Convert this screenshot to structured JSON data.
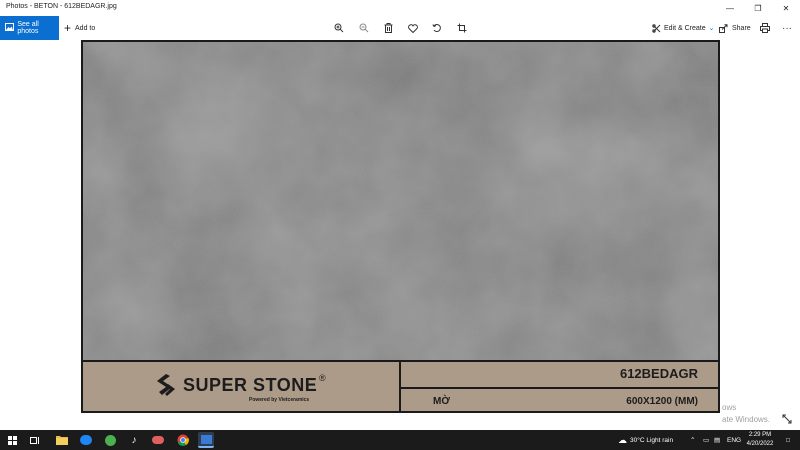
{
  "window": {
    "title": "Photos - BETON - 612BEDAGR.jpg",
    "minimize_glyph": "—",
    "maximize_glyph": "❐",
    "close_glyph": "✕"
  },
  "toolbar": {
    "see_all_label": "See all photos",
    "add_to_label": "Add to",
    "add_to_glyph": "+",
    "edit_create_label": "Edit & Create",
    "share_label": "Share",
    "more_glyph": "···"
  },
  "photo": {
    "brand_name": "SUPER STONE",
    "brand_registered": "®",
    "brand_tagline": "Powered by Vietceramics",
    "product_code": "612BEDAGR",
    "finish": "MỜ",
    "size": "600X1200 (MM)"
  },
  "watermark": {
    "line1": "ows",
    "line2": "ate Windows."
  },
  "taskbar": {
    "weather": "30°C  Light rain",
    "language": "ENG",
    "time": "2:29 PM",
    "date": "4/20/2022"
  },
  "icons": [
    "windows-start",
    "task-view",
    "file-explorer",
    "zalo",
    "chat-app",
    "tiktok",
    "cloud-app",
    "chrome",
    "photos-app",
    "zoom-in",
    "zoom-out",
    "delete",
    "favorite",
    "rotate",
    "crop",
    "edit",
    "share",
    "print",
    "more",
    "weather",
    "chevron-up",
    "network",
    "volume",
    "notification"
  ],
  "colors": {
    "accent": "#0a6fd1",
    "label_panel": "#ad9b89",
    "taskbar": "#1b1b1b",
    "concrete": "#777777"
  }
}
